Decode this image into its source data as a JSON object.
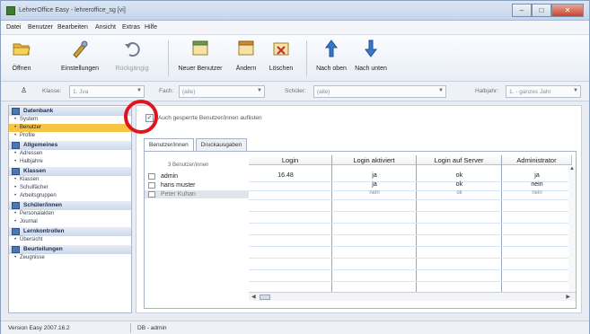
{
  "window": {
    "title": "LehrerOffice Easy - lehreroffice_sg  [vi]"
  },
  "menu": [
    "Datei",
    "Benutzer",
    "Bearbeiten",
    "Ansicht",
    "Extras",
    "Hilfe"
  ],
  "toolbar": {
    "open": "Öffnen",
    "settings": "Einstellungen",
    "undo": "Rückgängig",
    "new_user": "Neuer Benutzer",
    "change": "Ändern",
    "delete": "Löschen",
    "move_up": "Nach oben",
    "move_down": "Nach unten"
  },
  "filters": {
    "class_label": "Klasse:",
    "class_value": "1. Jva",
    "subject_label": "Fach:",
    "subject_value": "(alle)",
    "period_label": "Schüler:",
    "period_value": "(alle)",
    "half_label": "Halbjahr:",
    "half_value": "1. - ganzes Jahr"
  },
  "sidebar": {
    "groups": [
      {
        "title": "Datenbank",
        "items": [
          "System",
          "Benutzer",
          "Profile"
        ]
      },
      {
        "title": "Allgemeines",
        "items": [
          "Adressen",
          "Halbjahre"
        ]
      },
      {
        "title": "Klassen",
        "items": [
          "Klassen",
          "Schulfächer",
          "Arbeitsgruppen"
        ]
      },
      {
        "title": "Schüler/innen",
        "items": [
          "Personalakten",
          "Journal"
        ]
      },
      {
        "title": "Lernkontrollen",
        "items": [
          "Übersicht"
        ]
      },
      {
        "title": "Beurteilungen",
        "items": [
          "Zeugnisse"
        ]
      }
    ],
    "active": "Benutzer"
  },
  "content": {
    "checkbox_label": "Auch gesperrte Benutzer/innen auflisten",
    "tabs": [
      "Benutzer/innen",
      "Druckausgaben"
    ],
    "count_label": "3 Benutzer/innen",
    "users": [
      "admin",
      "hans muster",
      "Peter Kuhan"
    ],
    "columns": [
      "Login",
      "Login aktiviert",
      "Login auf Server",
      "Administrator"
    ],
    "rows": [
      [
        "16.48",
        "ja",
        "ok",
        "ja"
      ],
      [
        "",
        "ja",
        "ok",
        "nein"
      ],
      [
        "",
        "nein",
        "ok",
        "nein"
      ]
    ]
  },
  "status": {
    "version": "Version Easy 2007.16.2",
    "user": "DB - admin"
  }
}
